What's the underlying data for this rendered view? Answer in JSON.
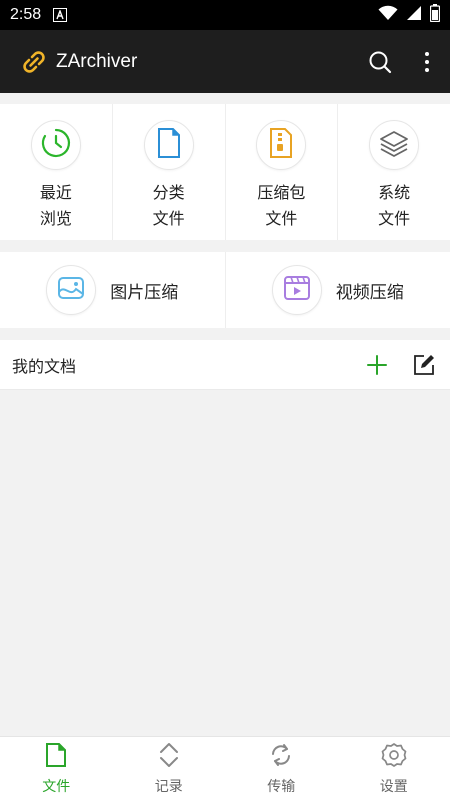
{
  "status_bar": {
    "time": "2:58",
    "icons": [
      "notification-a-icon",
      "wifi-icon",
      "signal-icon",
      "battery-icon"
    ]
  },
  "app_bar": {
    "title": "ZArchiver",
    "icons": [
      "chain-link-logo-icon",
      "search-icon",
      "more-vert-icon"
    ]
  },
  "quick_grid": [
    {
      "line1": "最近",
      "line2": "浏览",
      "icon": "clock-icon",
      "color": "#2bb52b"
    },
    {
      "line1": "分类",
      "line2": "文件",
      "icon": "file-icon",
      "color": "#2b8fd6"
    },
    {
      "line1": "压缩包",
      "line2": "文件",
      "icon": "archive-icon",
      "color": "#e8a323"
    },
    {
      "line1": "系统",
      "line2": "文件",
      "icon": "layers-icon",
      "color": "#666666"
    }
  ],
  "compress_row": [
    {
      "label": "图片压缩",
      "icon": "image-icon",
      "color": "#5bb6e6"
    },
    {
      "label": "视频压缩",
      "icon": "video-icon",
      "color": "#a87de0"
    }
  ],
  "docs": {
    "title": "我的文档",
    "add_icon_color": "#2aa52a"
  },
  "bottom_nav": [
    {
      "label": "文件",
      "icon": "file-icon",
      "active": true
    },
    {
      "label": "记录",
      "icon": "sort-icon",
      "active": false
    },
    {
      "label": "传输",
      "icon": "sync-icon",
      "active": false
    },
    {
      "label": "设置",
      "icon": "gear-icon",
      "active": false
    }
  ],
  "colors": {
    "accent": "#2aa52a",
    "app_bar": "#1e1e1e",
    "logo": "#f0b429"
  }
}
